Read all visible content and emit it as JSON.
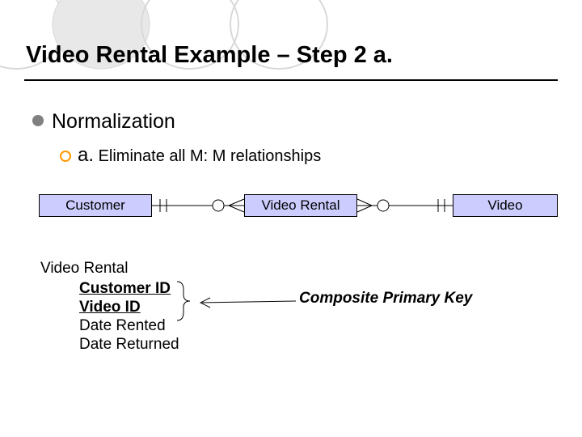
{
  "title": "Video Rental Example – Step 2 a.",
  "bullets": {
    "l1": "Normalization",
    "l2a": "a.",
    "l2b": " Eliminate all M: M relationships"
  },
  "entities": {
    "customer": "Customer",
    "video_rental": "Video Rental",
    "video": "Video"
  },
  "table": {
    "name": "Video Rental",
    "attrs": [
      "Customer ID",
      "Video ID",
      "Date Rented",
      "Date Returned"
    ]
  },
  "annotation": "Composite Primary Key"
}
